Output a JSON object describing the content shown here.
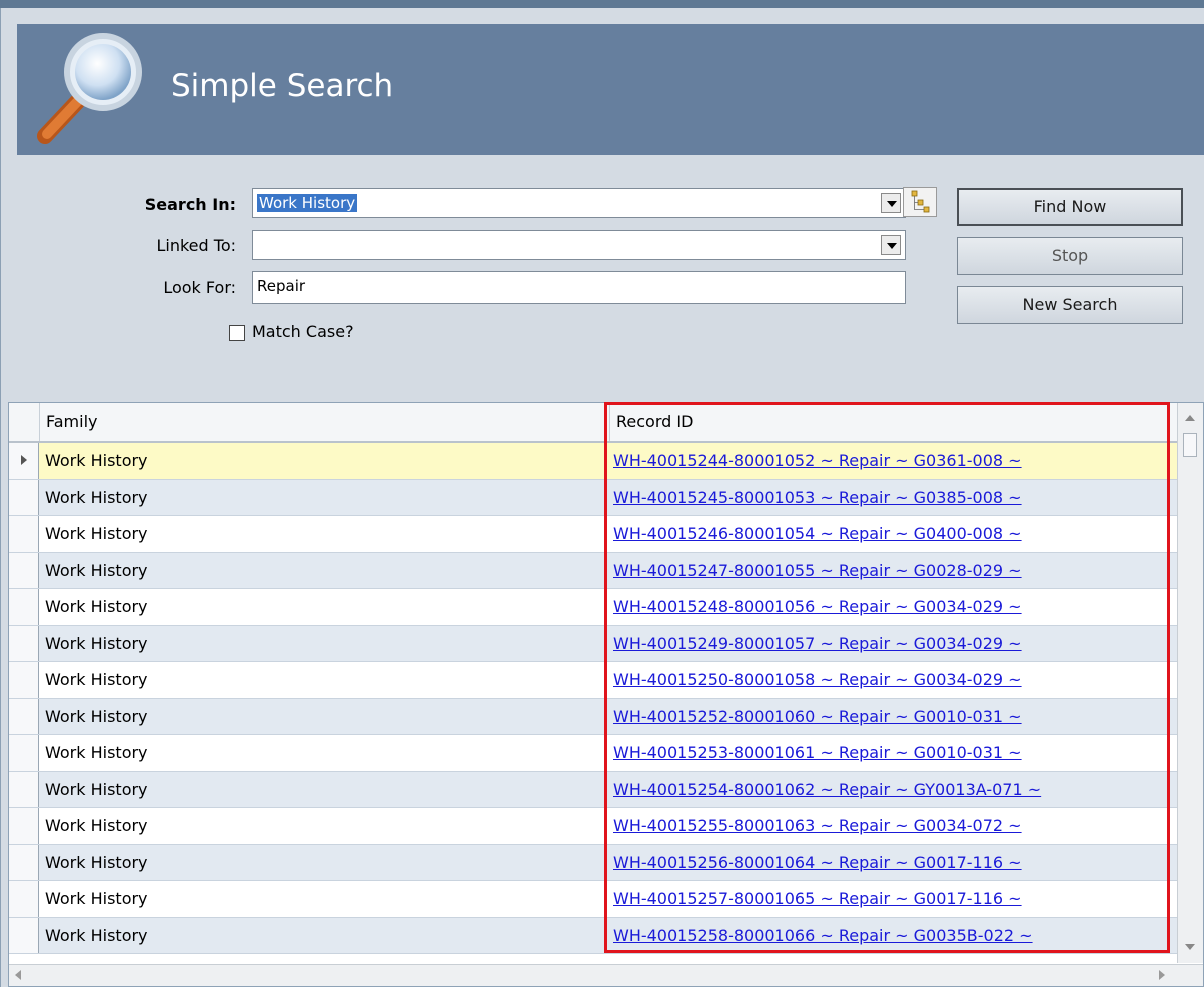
{
  "header": {
    "title": "Simple Search"
  },
  "form": {
    "search_in_label": "Search In:",
    "search_in_value": "Work History",
    "linked_to_label": "Linked To:",
    "linked_to_value": "",
    "look_for_label": "Look For:",
    "look_for_value": "Repair",
    "match_case_label": "Match Case?",
    "match_case_checked": false
  },
  "buttons": {
    "find_now": "Find Now",
    "stop": "Stop",
    "new_search": "New Search"
  },
  "grid": {
    "columns": [
      "Family",
      "Record ID"
    ],
    "rows": [
      {
        "family": "Work History",
        "record_id": "WH-40015244-80001052 ~ Repair ~ G0361-008 ~"
      },
      {
        "family": "Work History",
        "record_id": "WH-40015245-80001053 ~ Repair ~ G0385-008 ~"
      },
      {
        "family": "Work History",
        "record_id": "WH-40015246-80001054 ~ Repair ~ G0400-008 ~"
      },
      {
        "family": "Work History",
        "record_id": "WH-40015247-80001055 ~ Repair ~ G0028-029 ~"
      },
      {
        "family": "Work History",
        "record_id": "WH-40015248-80001056 ~ Repair ~ G0034-029 ~"
      },
      {
        "family": "Work History",
        "record_id": "WH-40015249-80001057 ~ Repair ~ G0034-029 ~"
      },
      {
        "family": "Work History",
        "record_id": "WH-40015250-80001058 ~ Repair ~ G0034-029 ~"
      },
      {
        "family": "Work History",
        "record_id": "WH-40015252-80001060 ~ Repair ~ G0010-031 ~"
      },
      {
        "family": "Work History",
        "record_id": "WH-40015253-80001061 ~ Repair ~ G0010-031 ~"
      },
      {
        "family": "Work History",
        "record_id": "WH-40015254-80001062 ~ Repair ~ GY0013A-071 ~"
      },
      {
        "family": "Work History",
        "record_id": "WH-40015255-80001063 ~ Repair ~ G0034-072 ~"
      },
      {
        "family": "Work History",
        "record_id": "WH-40015256-80001064 ~ Repair ~ G0017-116 ~"
      },
      {
        "family": "Work History",
        "record_id": "WH-40015257-80001065 ~ Repair ~ G0017-116 ~"
      },
      {
        "family": "Work History",
        "record_id": "WH-40015258-80001066 ~ Repair ~ G0035B-022 ~"
      }
    ]
  },
  "colors": {
    "header_bg": "#667f9e",
    "link": "#1a1ad8",
    "highlight": "#e0141c",
    "selected_row": "#fdfac6"
  }
}
